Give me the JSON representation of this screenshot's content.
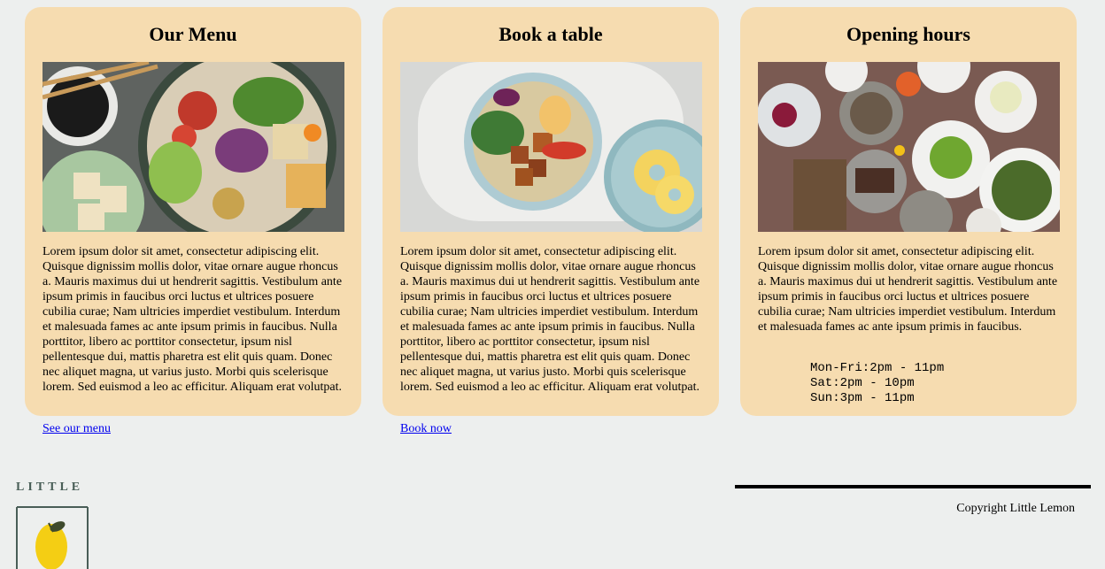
{
  "cards": [
    {
      "title": "Our Menu",
      "image": "salad-bowl-photo",
      "text": "Lorem ipsum dolor sit amet, consectetur adipiscing elit. Quisque dignissim mollis dolor, vitae ornare augue rhoncus a. Mauris maximus dui ut hendrerit sagittis. Vestibulum ante ipsum primis in faucibus orci luctus et ultrices posuere cubilia curae; Nam ultricies imperdiet vestibulum. Interdum et malesuada fames ac ante ipsum primis in faucibus. Nulla porttitor, libero ac porttitor consectetur, ipsum nisl pellentesque dui, mattis pharetra est elit quis quam. Donec nec aliquet magna, ut varius justo. Morbi quis scelerisque lorem. Sed euismod a leo ac efficitur. Aliquam erat volutpat.",
      "link": "See our menu"
    },
    {
      "title": "Book a table",
      "image": "tofu-bowl-photo",
      "text": "Lorem ipsum dolor sit amet, consectetur adipiscing elit. Quisque dignissim mollis dolor, vitae ornare augue rhoncus a. Mauris maximus dui ut hendrerit sagittis. Vestibulum ante ipsum primis in faucibus orci luctus et ultrices posuere cubilia curae; Nam ultricies imperdiet vestibulum. Interdum et malesuada fames ac ante ipsum primis in faucibus. Nulla porttitor, libero ac porttitor consectetur, ipsum nisl pellentesque dui, mattis pharetra est elit quis quam. Donec nec aliquet magna, ut varius justo. Morbi quis scelerisque lorem. Sed euismod a leo ac efficitur. Aliquam erat volutpat.",
      "link": "Book now"
    },
    {
      "title": "Opening hours",
      "image": "dining-table-photo",
      "text": "Lorem ipsum dolor sit amet, consectetur adipiscing elit. Quisque dignissim mollis dolor, vitae ornare augue rhoncus a. Mauris maximus dui ut hendrerit sagittis. Vestibulum ante ipsum primis in faucibus orci luctus et ultrices posuere cubilia curae; Nam ultricies imperdiet vestibulum. Interdum et malesuada fames ac ante ipsum primis in faucibus.",
      "hours": [
        "Mon-Fri:2pm - 11pm",
        "Sat:2pm - 10pm",
        "Sun:3pm - 11pm"
      ]
    }
  ],
  "footer": {
    "logo_text": "LITTLE",
    "logo_icon": "lemon-logo-icon",
    "copyright": "Copyright Little Lemon"
  },
  "colors": {
    "background": "#edefee",
    "card": "#f6dcb0",
    "logo_green": "#495e57",
    "lemon": "#f4ce14"
  }
}
